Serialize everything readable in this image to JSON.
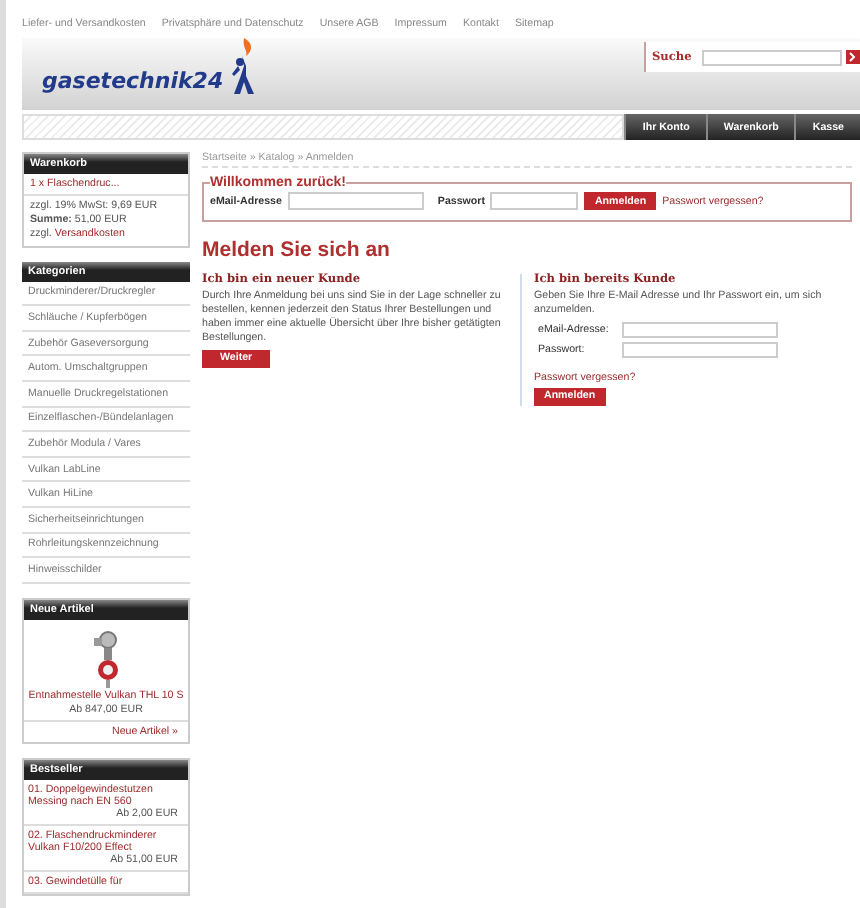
{
  "top_links": [
    "Liefer- und Versandkosten",
    "Privatsphäre und Datenschutz",
    "Unsere AGB",
    "Impressum",
    "Kontakt",
    "Sitemap"
  ],
  "header": {
    "logo": "gasetechnik24",
    "search_label": "Suche"
  },
  "nav": [
    "Ihr Konto",
    "Warenkorb",
    "Kasse"
  ],
  "cart": {
    "title": "Warenkorb",
    "item": "1 x Flaschendruc...",
    "tax": "zzgl. 19% MwSt: 9,69 EUR",
    "sum": "**Summe:** 51,00 EUR",
    "shipping_prefix": "zzgl.",
    "shipping_link": "Versandkosten"
  },
  "categories": {
    "title": "Kategorien",
    "items": [
      "Druckminderer/Druckregler",
      "Schläuche / Kupferbögen",
      "Zubehör Gaseversorgung",
      "Autom. Umschaltgruppen",
      "Manuelle Druckregelstationen",
      "Einzelflaschen-/Bündelanlagen",
      "Zubehör Modula / Vares",
      "Vulkan LabLine",
      "Vulkan HiLine",
      "Sicherheitseinrichtungen",
      "Rohrleitungskennzeichnung",
      "Hinweisschilder"
    ]
  },
  "new_articles": {
    "title": "Neue Artikel",
    "name": "Entnahmestelle Vulkan THL 10 S",
    "price": "Ab 847,00 EUR",
    "more": "Neue Artikel »"
  },
  "bestseller": {
    "title": "Bestseller",
    "items": [
      {
        "name": "01. Doppelgewindestutzen Messing nach EN 560",
        "price": "Ab 2,00 EUR"
      },
      {
        "name": "02. Flaschendruckminderer Vulkan F10/200 Effect",
        "price": "Ab 51,00 EUR"
      },
      {
        "name": "03. Gewindetülle für"
      }
    ]
  },
  "breadcrumb": "Startseite » Katalog » Anmelden",
  "welcome": {
    "legend": "Willkommen zurück!",
    "email_label": "eMail-Adresse",
    "password_label": "Passwort",
    "button": "Anmelden",
    "forgot": "Passwort vergessen?"
  },
  "heading": "Melden Sie sich an",
  "new_customer": {
    "title": "Ich bin ein neuer Kunde",
    "text": "Durch Ihre Anmeldung bei uns sind Sie in der Lage schneller zu bestellen, kennen jederzeit den Status Ihrer Bestellungen und haben immer eine aktuelle Übersicht über Ihre bisher getätigten Bestellungen.",
    "button": "Weiter"
  },
  "existing_customer": {
    "title": "Ich bin bereits Kunde",
    "text": "Geben Sie Ihre E-Mail Adresse und Ihr Passwort ein, um sich anzumelden.",
    "email_label": "eMail-Adresse:",
    "password_label": "Passwort:",
    "forgot": "Passwort vergessen?",
    "button": "Anmelden"
  }
}
